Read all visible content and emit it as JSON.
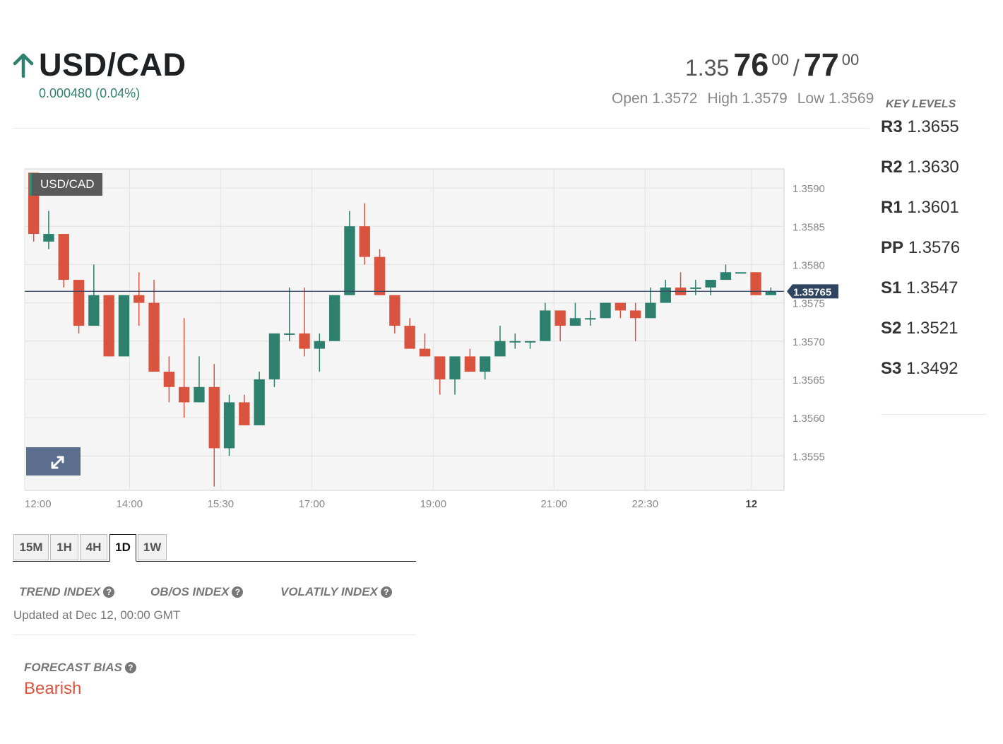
{
  "header": {
    "pair": "USD/CAD",
    "change": "0.000480 (0.04%)",
    "bid_prefix": "1.35",
    "bid_big": "76",
    "bid_sup": "00",
    "separator": "/",
    "ask_big": "77",
    "ask_sup": "00",
    "open": "Open 1.3572",
    "high": "High 1.3579",
    "low": "Low 1.3569"
  },
  "key_levels": {
    "title": "KEY LEVELS",
    "items": [
      {
        "label": "R3",
        "value": "1.3655"
      },
      {
        "label": "R2",
        "value": "1.3630"
      },
      {
        "label": "R1",
        "value": "1.3601"
      },
      {
        "label": "PP",
        "value": "1.3576"
      },
      {
        "label": "S1",
        "value": "1.3547"
      },
      {
        "label": "S2",
        "value": "1.3521"
      },
      {
        "label": "S3",
        "value": "1.3492"
      }
    ]
  },
  "colors": {
    "up": "#2d7f6e",
    "down": "#d9533f",
    "bearish": "#d9533f"
  },
  "chart_label": "USD/CAD",
  "expand_icon": "expand-icon",
  "chart_data": {
    "type": "candlestick",
    "ylim": [
      1.35505,
      1.35925
    ],
    "yticks": [
      "1.3590",
      "1.3585",
      "1.3580",
      "1.3575",
      "1.3570",
      "1.3565",
      "1.3560",
      "1.3555"
    ],
    "xticks": [
      {
        "label": "12:00",
        "bold": false
      },
      {
        "label": "14:00",
        "bold": false
      },
      {
        "label": "15:30",
        "bold": false
      },
      {
        "label": "17:00",
        "bold": false
      },
      {
        "label": "19:00",
        "bold": false
      },
      {
        "label": "21:00",
        "bold": false
      },
      {
        "label": "22:30",
        "bold": false
      },
      {
        "label": "12",
        "bold": true
      }
    ],
    "current_price": "1.35765",
    "current_value": 1.35765,
    "candles": [
      [
        1.3592,
        1.3584,
        1.3592,
        1.3583
      ],
      [
        1.3583,
        1.3584,
        1.3587,
        1.3582
      ],
      [
        1.3584,
        1.3578,
        1.3584,
        1.3577
      ],
      [
        1.3578,
        1.3572,
        1.3578,
        1.3571
      ],
      [
        1.3572,
        1.3576,
        1.358,
        1.3572
      ],
      [
        1.3576,
        1.3568,
        1.3576,
        1.3568
      ],
      [
        1.3568,
        1.3576,
        1.3576,
        1.3568
      ],
      [
        1.3576,
        1.3575,
        1.3579,
        1.3572
      ],
      [
        1.3575,
        1.3566,
        1.3578,
        1.3566
      ],
      [
        1.3566,
        1.3564,
        1.3568,
        1.3562
      ],
      [
        1.3564,
        1.3562,
        1.3573,
        1.356
      ],
      [
        1.3562,
        1.3564,
        1.3568,
        1.3562
      ],
      [
        1.3564,
        1.3556,
        1.3567,
        1.3551
      ],
      [
        1.3556,
        1.3562,
        1.3563,
        1.3555
      ],
      [
        1.3562,
        1.3559,
        1.3563,
        1.3559
      ],
      [
        1.3559,
        1.3565,
        1.3566,
        1.3559
      ],
      [
        1.3565,
        1.3571,
        1.3571,
        1.3564
      ],
      [
        1.3571,
        1.3571,
        1.3577,
        1.357
      ],
      [
        1.3571,
        1.3569,
        1.3577,
        1.3568
      ],
      [
        1.3569,
        1.357,
        1.3571,
        1.3566
      ],
      [
        1.357,
        1.3576,
        1.3576,
        1.357
      ],
      [
        1.3576,
        1.3585,
        1.3587,
        1.3576
      ],
      [
        1.3585,
        1.3581,
        1.3588,
        1.358
      ],
      [
        1.3581,
        1.3576,
        1.3582,
        1.3576
      ],
      [
        1.3576,
        1.3572,
        1.3576,
        1.3571
      ],
      [
        1.3572,
        1.3569,
        1.3573,
        1.3569
      ],
      [
        1.3569,
        1.3568,
        1.3571,
        1.3568
      ],
      [
        1.3568,
        1.3565,
        1.3568,
        1.3563
      ],
      [
        1.3565,
        1.3568,
        1.3568,
        1.3563
      ],
      [
        1.3568,
        1.3566,
        1.3569,
        1.3566
      ],
      [
        1.3566,
        1.3568,
        1.3568,
        1.3565
      ],
      [
        1.3568,
        1.357,
        1.3572,
        1.3568
      ],
      [
        1.357,
        1.357,
        1.3571,
        1.3569
      ],
      [
        1.357,
        1.357,
        1.357,
        1.3569
      ],
      [
        1.357,
        1.3574,
        1.3575,
        1.357
      ],
      [
        1.3574,
        1.3572,
        1.3574,
        1.357
      ],
      [
        1.3572,
        1.3573,
        1.3575,
        1.3572
      ],
      [
        1.3573,
        1.3573,
        1.3574,
        1.3572
      ],
      [
        1.3573,
        1.3575,
        1.3575,
        1.3573
      ],
      [
        1.3575,
        1.3574,
        1.3575,
        1.3573
      ],
      [
        1.3574,
        1.3573,
        1.3575,
        1.357
      ],
      [
        1.3573,
        1.3575,
        1.3577,
        1.3573
      ],
      [
        1.3575,
        1.3577,
        1.3578,
        1.3575
      ],
      [
        1.3577,
        1.3576,
        1.3579,
        1.3576
      ],
      [
        1.3577,
        1.3577,
        1.3578,
        1.3576
      ],
      [
        1.3577,
        1.3578,
        1.3578,
        1.3576
      ],
      [
        1.3578,
        1.3579,
        1.358,
        1.3578
      ],
      [
        1.3579,
        1.3579,
        1.3579,
        1.3579
      ],
      [
        1.3579,
        1.3576,
        1.3579,
        1.3576
      ],
      [
        1.3576,
        1.35765,
        1.3577,
        1.3576
      ]
    ]
  },
  "tabs": [
    "15M",
    "1H",
    "4H",
    "1D",
    "1W"
  ],
  "active_tab": "1D",
  "indices": {
    "trend": "TREND INDEX",
    "obos": "OB/OS INDEX",
    "volatility": "VOLATILY INDEX",
    "help_glyph": "?"
  },
  "updated": "Updated at Dec 12, 00:00 GMT",
  "forecast": {
    "title": "FORECAST BIAS",
    "value": "Bearish"
  }
}
